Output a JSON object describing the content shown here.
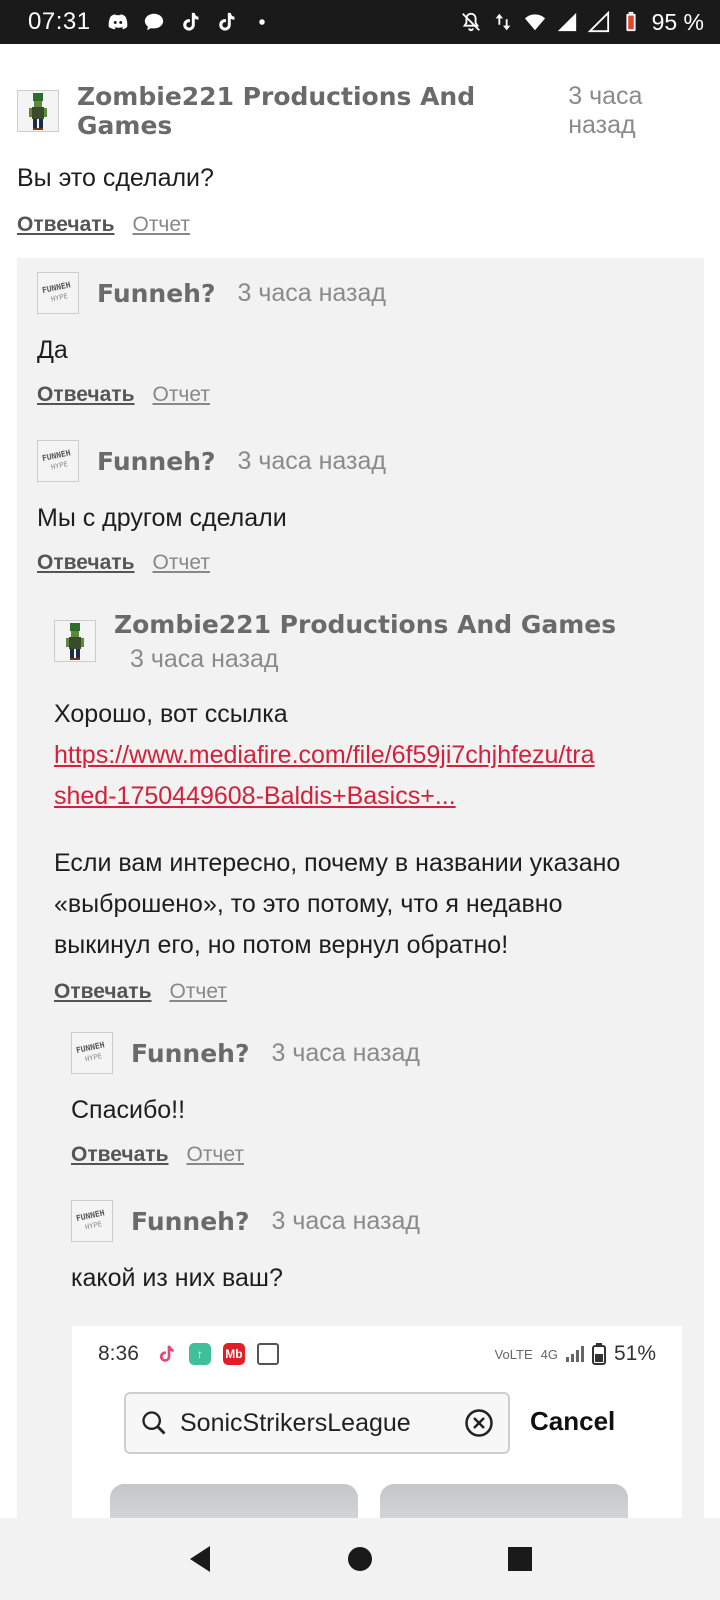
{
  "status_bar": {
    "time": "07:31",
    "battery": "95 %",
    "left_icons": [
      "discord-icon",
      "chat-icon",
      "tiktok-icon",
      "tiktok-icon",
      "dot-icon"
    ],
    "right_icons": [
      "bell-off-icon",
      "data-arrows-icon",
      "wifi-icon",
      "signal-icon",
      "signal-icon",
      "battery-icon"
    ]
  },
  "comments": [
    {
      "author": "Zombie221 Productions And Games",
      "time": "3 часа назад",
      "text": "Вы это сделали?",
      "reply": "Отвечать",
      "report": "Отчет"
    },
    {
      "author": "Funneh?",
      "time": "3 часа назад",
      "text": "Да",
      "reply": "Отвечать",
      "report": "Отчет"
    },
    {
      "author": "Funneh?",
      "time": "3 часа назад",
      "text": "Мы с другом сделали",
      "reply": "Отвечать",
      "report": "Отчет"
    },
    {
      "author": "Zombie221 Productions And Games",
      "time": "3 часа назад",
      "text": "Хорошо, вот ссылка",
      "link_line1": "https://www.mediafire.com/file/6f59ji7chjhfezu/tra",
      "link_line2": "shed-1750449608-Baldis+Basics+...",
      "text2_line1": "Если вам интересно, почему в названии указано",
      "text2_line2": "«выброшено», то это потому, что я недавно",
      "text2_line3": "выкинул его, но потом вернул обратно!",
      "reply": "Отвечать",
      "report": "Отчет"
    },
    {
      "author": "Funneh?",
      "time": "3 часа назад",
      "text": "Спасибо!!",
      "reply": "Отвечать",
      "report": "Отчет"
    },
    {
      "author": "Funneh?",
      "time": "3 часа назад",
      "text": "какой из них ваш?"
    }
  ],
  "embedded_screenshot": {
    "time": "8:36",
    "battery": "51%",
    "network": "4G",
    "search_query": "SonicStrikersLeague",
    "cancel_label": "Cancel",
    "mini_icon_text": "Mb"
  },
  "nav_bar": {
    "buttons": [
      "back-icon",
      "home-icon",
      "recents-icon"
    ]
  }
}
